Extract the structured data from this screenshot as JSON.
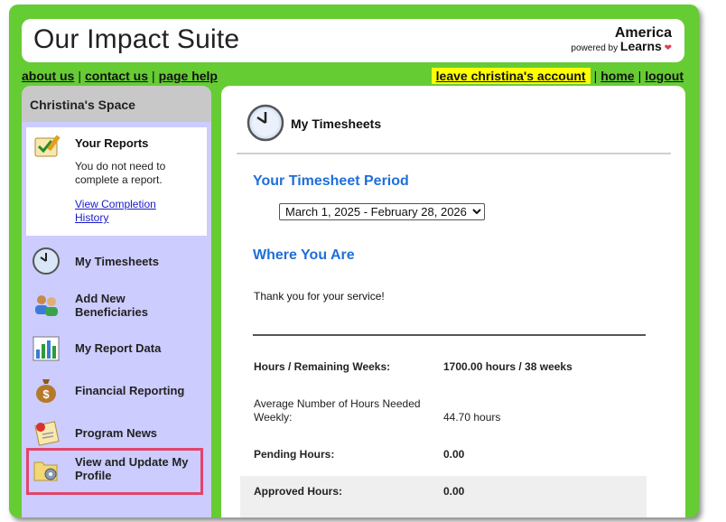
{
  "header": {
    "title": "Our Impact Suite",
    "brand_name": "America",
    "brand_powered": "powered by",
    "brand_learns": "Learns"
  },
  "top_links": {
    "about": "about us",
    "contact": "contact us",
    "help": "page help",
    "leave": "leave christina's account",
    "home": "home",
    "logout": "logout"
  },
  "sidebar": {
    "heading": "Christina's Space",
    "reports": {
      "title": "Your Reports",
      "text": "You do not need to complete a report.",
      "link": "View Completion History"
    },
    "items": [
      {
        "label": "My Timesheets",
        "icon": "clock-icon"
      },
      {
        "label": "Add New Beneficiaries",
        "icon": "people-icon"
      },
      {
        "label": "My Report Data",
        "icon": "bar-chart-icon"
      },
      {
        "label": "Financial Reporting",
        "icon": "money-bag-icon"
      },
      {
        "label": "Program News",
        "icon": "news-icon"
      },
      {
        "label": "View and Update My Profile",
        "icon": "profile-folder-icon"
      }
    ]
  },
  "main": {
    "title": "My Timesheets",
    "period_heading": "Your Timesheet Period",
    "period_selected": "March 1, 2025 - February 28, 2026",
    "where_heading": "Where You Are",
    "thanks": "Thank you for your service!",
    "rows": [
      {
        "label": "Hours / Remaining Weeks:",
        "value": "1700.00 hours / 38 weeks"
      },
      {
        "label": "Average Number of Hours Needed Weekly:",
        "value": "44.70 hours"
      },
      {
        "label": "Pending Hours:",
        "value": "0.00"
      },
      {
        "label": "Approved Hours:",
        "value": "0.00"
      }
    ]
  },
  "colors": {
    "frame_green": "#66cc33",
    "sidebar_lavender": "#ccccff",
    "heading_blue": "#1f6fd8",
    "leave_highlight": "#ffff00",
    "annotation_pink": "#e0456b"
  }
}
